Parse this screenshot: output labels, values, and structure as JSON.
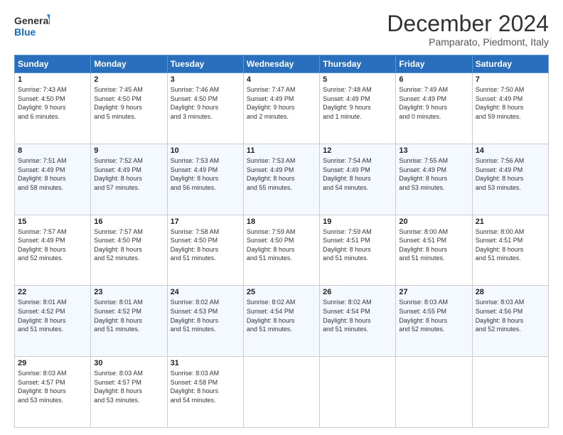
{
  "logo": {
    "text_general": "General",
    "text_blue": "Blue"
  },
  "header": {
    "title": "December 2024",
    "subtitle": "Pamparato, Piedmont, Italy"
  },
  "columns": [
    "Sunday",
    "Monday",
    "Tuesday",
    "Wednesday",
    "Thursday",
    "Friday",
    "Saturday"
  ],
  "weeks": [
    [
      {
        "day": "1",
        "lines": [
          "Sunrise: 7:43 AM",
          "Sunset: 4:50 PM",
          "Daylight: 9 hours",
          "and 6 minutes."
        ]
      },
      {
        "day": "2",
        "lines": [
          "Sunrise: 7:45 AM",
          "Sunset: 4:50 PM",
          "Daylight: 9 hours",
          "and 5 minutes."
        ]
      },
      {
        "day": "3",
        "lines": [
          "Sunrise: 7:46 AM",
          "Sunset: 4:50 PM",
          "Daylight: 9 hours",
          "and 3 minutes."
        ]
      },
      {
        "day": "4",
        "lines": [
          "Sunrise: 7:47 AM",
          "Sunset: 4:49 PM",
          "Daylight: 9 hours",
          "and 2 minutes."
        ]
      },
      {
        "day": "5",
        "lines": [
          "Sunrise: 7:48 AM",
          "Sunset: 4:49 PM",
          "Daylight: 9 hours",
          "and 1 minute."
        ]
      },
      {
        "day": "6",
        "lines": [
          "Sunrise: 7:49 AM",
          "Sunset: 4:49 PM",
          "Daylight: 9 hours",
          "and 0 minutes."
        ]
      },
      {
        "day": "7",
        "lines": [
          "Sunrise: 7:50 AM",
          "Sunset: 4:49 PM",
          "Daylight: 8 hours",
          "and 59 minutes."
        ]
      }
    ],
    [
      {
        "day": "8",
        "lines": [
          "Sunrise: 7:51 AM",
          "Sunset: 4:49 PM",
          "Daylight: 8 hours",
          "and 58 minutes."
        ]
      },
      {
        "day": "9",
        "lines": [
          "Sunrise: 7:52 AM",
          "Sunset: 4:49 PM",
          "Daylight: 8 hours",
          "and 57 minutes."
        ]
      },
      {
        "day": "10",
        "lines": [
          "Sunrise: 7:53 AM",
          "Sunset: 4:49 PM",
          "Daylight: 8 hours",
          "and 56 minutes."
        ]
      },
      {
        "day": "11",
        "lines": [
          "Sunrise: 7:53 AM",
          "Sunset: 4:49 PM",
          "Daylight: 8 hours",
          "and 55 minutes."
        ]
      },
      {
        "day": "12",
        "lines": [
          "Sunrise: 7:54 AM",
          "Sunset: 4:49 PM",
          "Daylight: 8 hours",
          "and 54 minutes."
        ]
      },
      {
        "day": "13",
        "lines": [
          "Sunrise: 7:55 AM",
          "Sunset: 4:49 PM",
          "Daylight: 8 hours",
          "and 53 minutes."
        ]
      },
      {
        "day": "14",
        "lines": [
          "Sunrise: 7:56 AM",
          "Sunset: 4:49 PM",
          "Daylight: 8 hours",
          "and 53 minutes."
        ]
      }
    ],
    [
      {
        "day": "15",
        "lines": [
          "Sunrise: 7:57 AM",
          "Sunset: 4:49 PM",
          "Daylight: 8 hours",
          "and 52 minutes."
        ]
      },
      {
        "day": "16",
        "lines": [
          "Sunrise: 7:57 AM",
          "Sunset: 4:50 PM",
          "Daylight: 8 hours",
          "and 52 minutes."
        ]
      },
      {
        "day": "17",
        "lines": [
          "Sunrise: 7:58 AM",
          "Sunset: 4:50 PM",
          "Daylight: 8 hours",
          "and 51 minutes."
        ]
      },
      {
        "day": "18",
        "lines": [
          "Sunrise: 7:59 AM",
          "Sunset: 4:50 PM",
          "Daylight: 8 hours",
          "and 51 minutes."
        ]
      },
      {
        "day": "19",
        "lines": [
          "Sunrise: 7:59 AM",
          "Sunset: 4:51 PM",
          "Daylight: 8 hours",
          "and 51 minutes."
        ]
      },
      {
        "day": "20",
        "lines": [
          "Sunrise: 8:00 AM",
          "Sunset: 4:51 PM",
          "Daylight: 8 hours",
          "and 51 minutes."
        ]
      },
      {
        "day": "21",
        "lines": [
          "Sunrise: 8:00 AM",
          "Sunset: 4:51 PM",
          "Daylight: 8 hours",
          "and 51 minutes."
        ]
      }
    ],
    [
      {
        "day": "22",
        "lines": [
          "Sunrise: 8:01 AM",
          "Sunset: 4:52 PM",
          "Daylight: 8 hours",
          "and 51 minutes."
        ]
      },
      {
        "day": "23",
        "lines": [
          "Sunrise: 8:01 AM",
          "Sunset: 4:52 PM",
          "Daylight: 8 hours",
          "and 51 minutes."
        ]
      },
      {
        "day": "24",
        "lines": [
          "Sunrise: 8:02 AM",
          "Sunset: 4:53 PM",
          "Daylight: 8 hours",
          "and 51 minutes."
        ]
      },
      {
        "day": "25",
        "lines": [
          "Sunrise: 8:02 AM",
          "Sunset: 4:54 PM",
          "Daylight: 8 hours",
          "and 51 minutes."
        ]
      },
      {
        "day": "26",
        "lines": [
          "Sunrise: 8:02 AM",
          "Sunset: 4:54 PM",
          "Daylight: 8 hours",
          "and 51 minutes."
        ]
      },
      {
        "day": "27",
        "lines": [
          "Sunrise: 8:03 AM",
          "Sunset: 4:55 PM",
          "Daylight: 8 hours",
          "and 52 minutes."
        ]
      },
      {
        "day": "28",
        "lines": [
          "Sunrise: 8:03 AM",
          "Sunset: 4:56 PM",
          "Daylight: 8 hours",
          "and 52 minutes."
        ]
      }
    ],
    [
      {
        "day": "29",
        "lines": [
          "Sunrise: 8:03 AM",
          "Sunset: 4:57 PM",
          "Daylight: 8 hours",
          "and 53 minutes."
        ]
      },
      {
        "day": "30",
        "lines": [
          "Sunrise: 8:03 AM",
          "Sunset: 4:57 PM",
          "Daylight: 8 hours",
          "and 53 minutes."
        ]
      },
      {
        "day": "31",
        "lines": [
          "Sunrise: 8:03 AM",
          "Sunset: 4:58 PM",
          "Daylight: 8 hours",
          "and 54 minutes."
        ]
      },
      null,
      null,
      null,
      null
    ]
  ]
}
